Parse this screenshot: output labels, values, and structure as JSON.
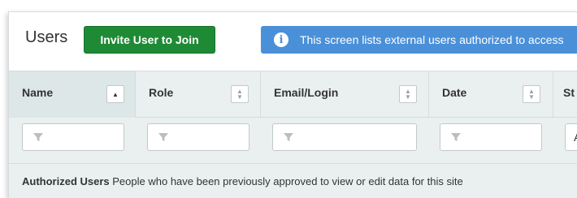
{
  "header": {
    "title": "Users",
    "invite_label": "Invite User to Join",
    "info_icon": "info-circle-icon",
    "info_text": "This screen lists external users authorized to access"
  },
  "table": {
    "columns": [
      {
        "label": "Name",
        "sort": "ascending"
      },
      {
        "label": "Role",
        "sort": "none"
      },
      {
        "label": "Email/Login",
        "sort": "none"
      },
      {
        "label": "Date",
        "sort": "none"
      },
      {
        "label": "St",
        "sort": "none"
      }
    ],
    "filters": {
      "filter_icon": "funnel-icon",
      "status_value": "A"
    }
  },
  "footer": {
    "heading": "Authorized Users",
    "description": "People who have been previously approved to view or edit data for this site"
  },
  "colors": {
    "invite_button": "#1f8a35",
    "info_banner": "#4a90d9",
    "table_header_bg": "#eaf0f0"
  }
}
